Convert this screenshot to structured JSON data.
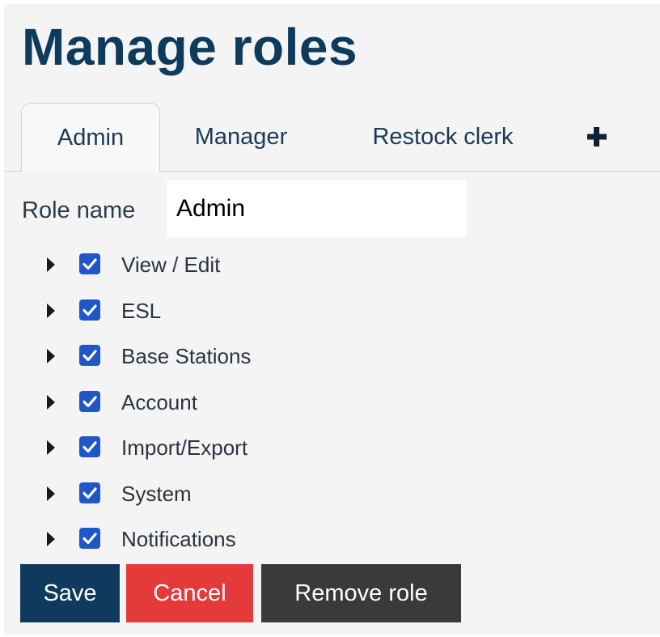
{
  "page": {
    "title": "Manage roles"
  },
  "tabs": [
    {
      "label": "Admin",
      "active": true
    },
    {
      "label": "Manager",
      "active": false
    },
    {
      "label": "Restock clerk",
      "active": false
    }
  ],
  "add_tab": {
    "icon": "plus-icon"
  },
  "role_name": {
    "label": "Role name",
    "value": "Admin"
  },
  "permissions": [
    {
      "label": "View / Edit",
      "checked": true
    },
    {
      "label": "ESL",
      "checked": true
    },
    {
      "label": "Base Stations",
      "checked": true
    },
    {
      "label": "Account",
      "checked": true
    },
    {
      "label": "Import/Export",
      "checked": true
    },
    {
      "label": "System",
      "checked": true
    },
    {
      "label": "Notifications",
      "checked": true
    }
  ],
  "actions": {
    "save_label": "Save",
    "cancel_label": "Cancel",
    "remove_label": "Remove role"
  },
  "colors": {
    "title": "#0e3a5c",
    "checkbox": "#1f56c8",
    "save": "#0f3a5e",
    "cancel": "#e53a3a",
    "remove": "#3a3a3a"
  },
  "icons": {
    "caret": "caret-right-icon",
    "check": "checkmark-icon",
    "add": "plus-icon"
  }
}
